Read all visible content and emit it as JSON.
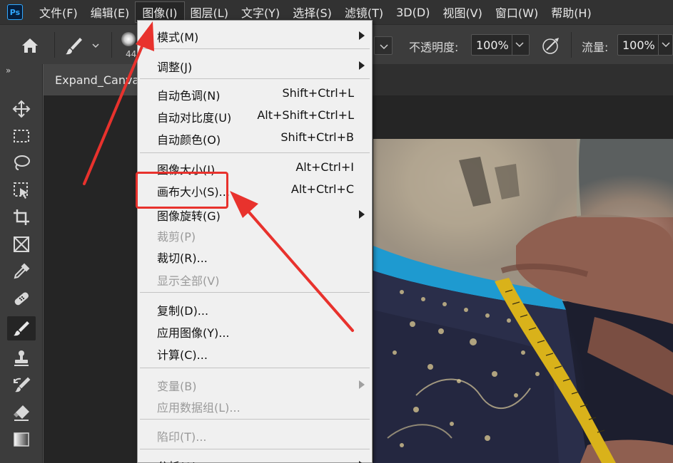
{
  "app": {
    "logo_text": "Ps"
  },
  "menubar": {
    "items": [
      {
        "label": "文件(F)"
      },
      {
        "label": "编辑(E)"
      },
      {
        "label": "图像(I)",
        "active": true
      },
      {
        "label": "图层(L)"
      },
      {
        "label": "文字(Y)"
      },
      {
        "label": "选择(S)"
      },
      {
        "label": "滤镜(T)"
      },
      {
        "label": "3D(D)"
      },
      {
        "label": "视图(V)"
      },
      {
        "label": "窗口(W)"
      },
      {
        "label": "帮助(H)"
      }
    ]
  },
  "options_bar": {
    "brush_size": "44",
    "opacity_label": "不透明度:",
    "opacity_value": "100%",
    "flow_label": "流量:",
    "flow_value": "100%"
  },
  "toolstrip": {
    "collapse_glyph": "»",
    "tools": [
      {
        "icon": "move-icon"
      },
      {
        "icon": "marquee-icon"
      },
      {
        "icon": "lasso-icon"
      },
      {
        "icon": "object-selection-icon"
      },
      {
        "icon": "crop-icon"
      },
      {
        "icon": "frame-icon"
      },
      {
        "icon": "eyedropper-icon"
      },
      {
        "icon": "healing-brush-icon"
      },
      {
        "icon": "brush-icon",
        "selected": true
      },
      {
        "icon": "stamp-icon"
      },
      {
        "icon": "history-brush-icon"
      },
      {
        "icon": "eraser-icon"
      },
      {
        "icon": "gradient-icon"
      }
    ]
  },
  "document": {
    "tab_title": "Expand_Canvas"
  },
  "dropdown": {
    "items": [
      {
        "label": "模式(M)",
        "shortcut": "",
        "submenu": true,
        "disabled": false
      },
      {
        "label": "调整(J)",
        "shortcut": "",
        "submenu": true,
        "disabled": false
      },
      {
        "label": "自动色调(N)",
        "shortcut": "Shift+Ctrl+L",
        "submenu": false,
        "disabled": false
      },
      {
        "label": "自动对比度(U)",
        "shortcut": "Alt+Shift+Ctrl+L",
        "submenu": false,
        "disabled": false
      },
      {
        "label": "自动颜色(O)",
        "shortcut": "Shift+Ctrl+B",
        "submenu": false,
        "disabled": false
      },
      {
        "label": "图像大小(I)...",
        "shortcut": "Alt+Ctrl+I",
        "submenu": false,
        "disabled": false
      },
      {
        "label": "画布大小(S)...",
        "shortcut": "Alt+Ctrl+C",
        "submenu": false,
        "disabled": false,
        "highlighted": true
      },
      {
        "label": "图像旋转(G)",
        "shortcut": "",
        "submenu": true,
        "disabled": false
      },
      {
        "label": "裁剪(P)",
        "shortcut": "",
        "submenu": false,
        "disabled": true
      },
      {
        "label": "裁切(R)...",
        "shortcut": "",
        "submenu": false,
        "disabled": false
      },
      {
        "label": "显示全部(V)",
        "shortcut": "",
        "submenu": false,
        "disabled": true
      },
      {
        "label": "复制(D)...",
        "shortcut": "",
        "submenu": false,
        "disabled": false
      },
      {
        "label": "应用图像(Y)...",
        "shortcut": "",
        "submenu": false,
        "disabled": false
      },
      {
        "label": "计算(C)...",
        "shortcut": "",
        "submenu": false,
        "disabled": false
      },
      {
        "label": "变量(B)",
        "shortcut": "",
        "submenu": true,
        "disabled": true
      },
      {
        "label": "应用数据组(L)...",
        "shortcut": "",
        "submenu": false,
        "disabled": true
      },
      {
        "label": "陷印(T)...",
        "shortcut": "",
        "submenu": false,
        "disabled": true
      },
      {
        "label": "分析(A)",
        "shortcut": "",
        "submenu": true,
        "disabled": false
      }
    ]
  },
  "annotation": {
    "color": "#e8322d"
  }
}
